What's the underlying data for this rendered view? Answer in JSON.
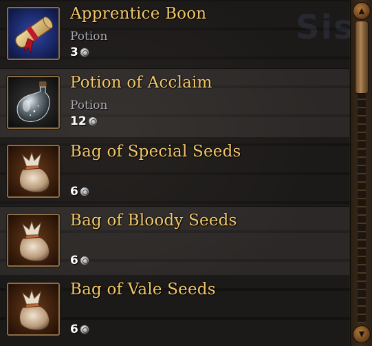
{
  "inventory": {
    "items": [
      {
        "name": "Apprentice Boon",
        "type": "Potion",
        "quantity": "3",
        "icon": "scroll-icon"
      },
      {
        "name": "Potion of Acclaim",
        "type": "Potion",
        "quantity": "12",
        "icon": "potion-flask-icon"
      },
      {
        "name": "Bag of Special Seeds",
        "type": "",
        "quantity": "6",
        "icon": "seed-bag-icon"
      },
      {
        "name": "Bag of Bloody Seeds",
        "type": "",
        "quantity": "6",
        "icon": "seed-bag-icon"
      },
      {
        "name": "Bag of Vale Seeds",
        "type": "",
        "quantity": "6",
        "icon": "seed-bag-icon"
      }
    ],
    "currency_icon": "silver-coin-icon"
  },
  "scrollbar": {
    "up_icon": "arrow-up-icon",
    "down_icon": "arrow-down-icon"
  },
  "colors": {
    "item_name": "#f2c76a",
    "item_type": "#a6a9b0",
    "quantity": "#ffffff",
    "frame": "#8c6f47"
  }
}
